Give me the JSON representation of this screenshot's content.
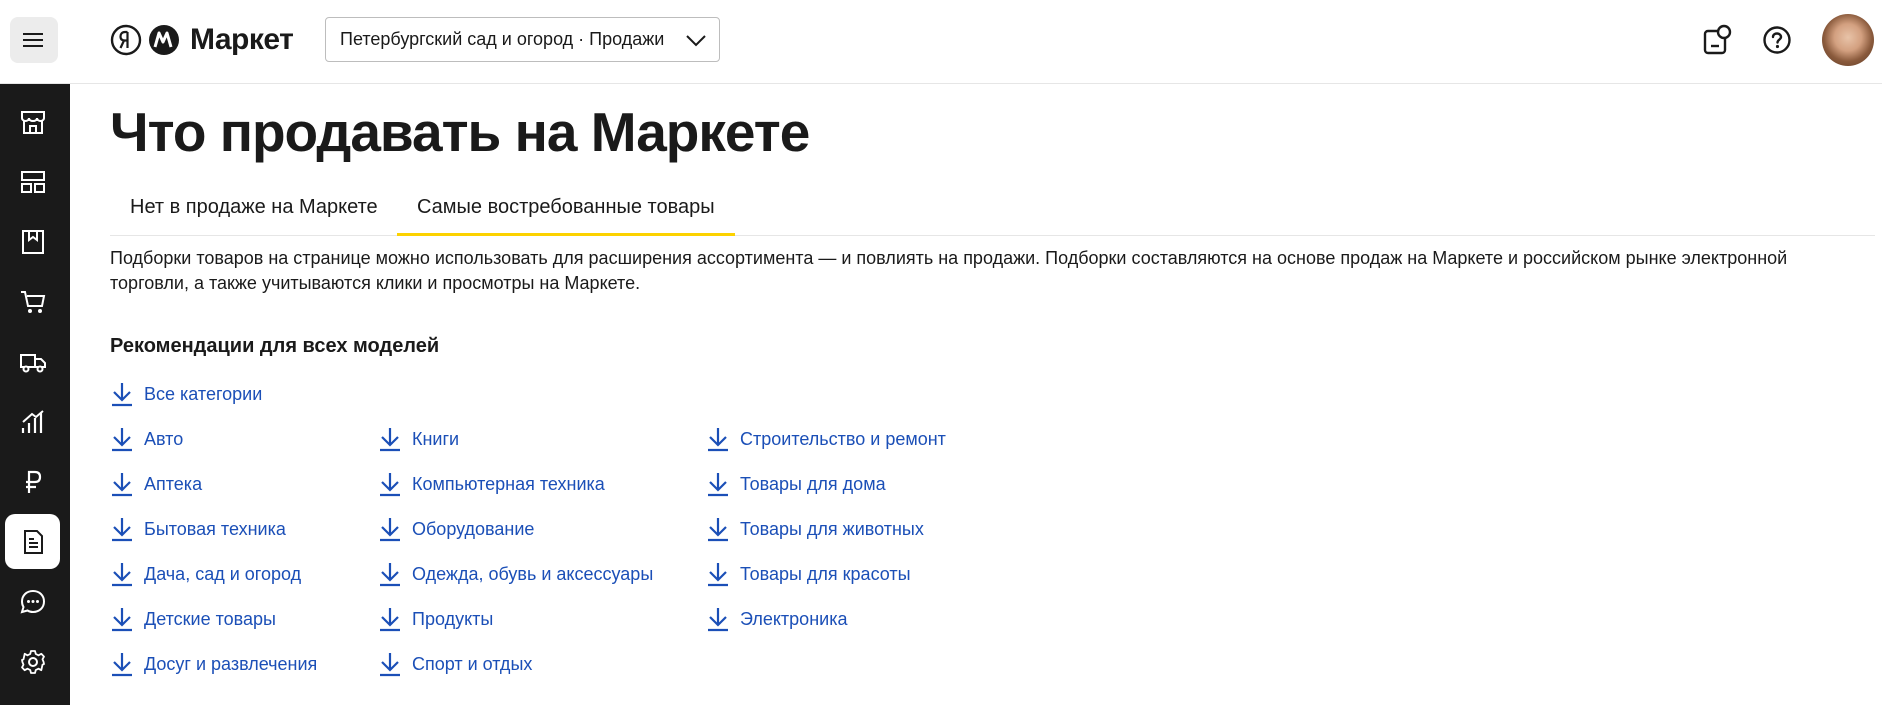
{
  "header": {
    "logo_text": "Маркет",
    "shop_selector": "Петербургский сад и огород · Продажи"
  },
  "sidebar": {
    "items": [
      {
        "icon": "store-icon"
      },
      {
        "icon": "layout-icon"
      },
      {
        "icon": "catalog-icon"
      },
      {
        "icon": "cart-icon"
      },
      {
        "icon": "truck-icon"
      },
      {
        "icon": "analytics-icon"
      },
      {
        "icon": "ruble-icon"
      },
      {
        "icon": "document-icon",
        "active": true
      },
      {
        "icon": "chat-icon"
      },
      {
        "icon": "gear-icon"
      }
    ]
  },
  "page": {
    "title": "Что продавать на Маркете",
    "tabs": [
      {
        "label": "Нет в продаже на Маркете",
        "active": false
      },
      {
        "label": "Самые востребованные товары",
        "active": true
      }
    ],
    "description": "Подборки товаров на странице можно использовать для расширения ассортимента — и повлиять на продажи. Подборки составляются на основе продаж на Маркете и российском рынке электронной торговли, а также учитываются клики и просмотры на Маркете.",
    "section_title": "Рекомендации для всех моделей",
    "all_categories": "Все категории",
    "columns": [
      [
        "Авто",
        "Аптека",
        "Бытовая техника",
        "Дача, сад и огород",
        "Детские товары",
        "Досуг и развлечения"
      ],
      [
        "Книги",
        "Компьютерная техника",
        "Оборудование",
        "Одежда, обувь и аксессуары",
        "Продукты",
        "Спорт и отдых"
      ],
      [
        "Строительство и ремонт",
        "Товары для дома",
        "Товары для животных",
        "Товары для красоты",
        "Электроника"
      ]
    ]
  },
  "colors": {
    "link": "#1b4fb7",
    "tab_accent": "#fcd200",
    "sidebar_bg": "#1a1a1a"
  }
}
